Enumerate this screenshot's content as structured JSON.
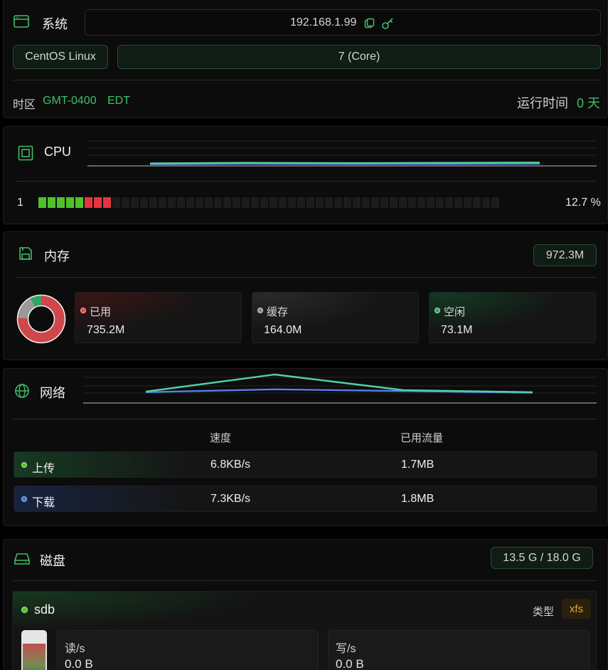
{
  "system": {
    "title": "系统",
    "ip": "192.168.1.99",
    "os_name": "CentOS Linux",
    "os_version": "7 (Core)",
    "timezone_label": "时区",
    "timezone_offset": "GMT-0400",
    "timezone_abbr": "EDT",
    "uptime_label": "运行时间",
    "uptime_value": "0 天"
  },
  "cpu": {
    "title": "CPU",
    "core_label": "1",
    "percent_text": "12.7 %",
    "segments_total": 50,
    "segments_green": 5,
    "segments_red": 3,
    "history": [
      0.09,
      0.11,
      0.1,
      0.11,
      0.12
    ],
    "history2": [
      0.06,
      0.08,
      0.07,
      0.07,
      0.08
    ]
  },
  "memory": {
    "title": "内存",
    "total": "972.3M",
    "used_label": "已用",
    "used_value": "735.2M",
    "cache_label": "缓存",
    "cache_value": "164.0M",
    "free_label": "空闲",
    "free_value": "73.1M",
    "donut": [
      {
        "name": "used",
        "value": 735.2,
        "color": "#d0474b"
      },
      {
        "name": "cache",
        "value": 164.0,
        "color": "#9a9a9a"
      },
      {
        "name": "free",
        "value": 73.1,
        "color": "#2fa561"
      }
    ]
  },
  "network": {
    "title": "网络",
    "col_speed": "速度",
    "col_traffic": "已用流量",
    "upload_label": "上传",
    "upload_speed": "6.8KB/s",
    "upload_traffic": "1.7MB",
    "download_label": "下载",
    "download_speed": "7.3KB/s",
    "download_traffic": "1.8MB",
    "history_up": [
      0.4,
      1.0,
      0.45,
      0.38
    ],
    "history_down": [
      0.38,
      0.48,
      0.42,
      0.36
    ]
  },
  "disk": {
    "title": "磁盘",
    "usage": "13.5 G / 18.0 G",
    "name": "sdb",
    "type_label": "类型",
    "type_value": "xfs",
    "read_label": "读/s",
    "read_value": "0.0 B",
    "write_label": "写/s",
    "write_value": "0.0 B",
    "fill_fraction": 0.75
  },
  "colors": {
    "accent": "#3fbf6a",
    "green_segment": "#4fc22a",
    "red_segment": "#e8333c",
    "line_green": "#4fd1a0",
    "line_blue": "#5a7ee8",
    "xfs_badge": "#e0a83a"
  }
}
